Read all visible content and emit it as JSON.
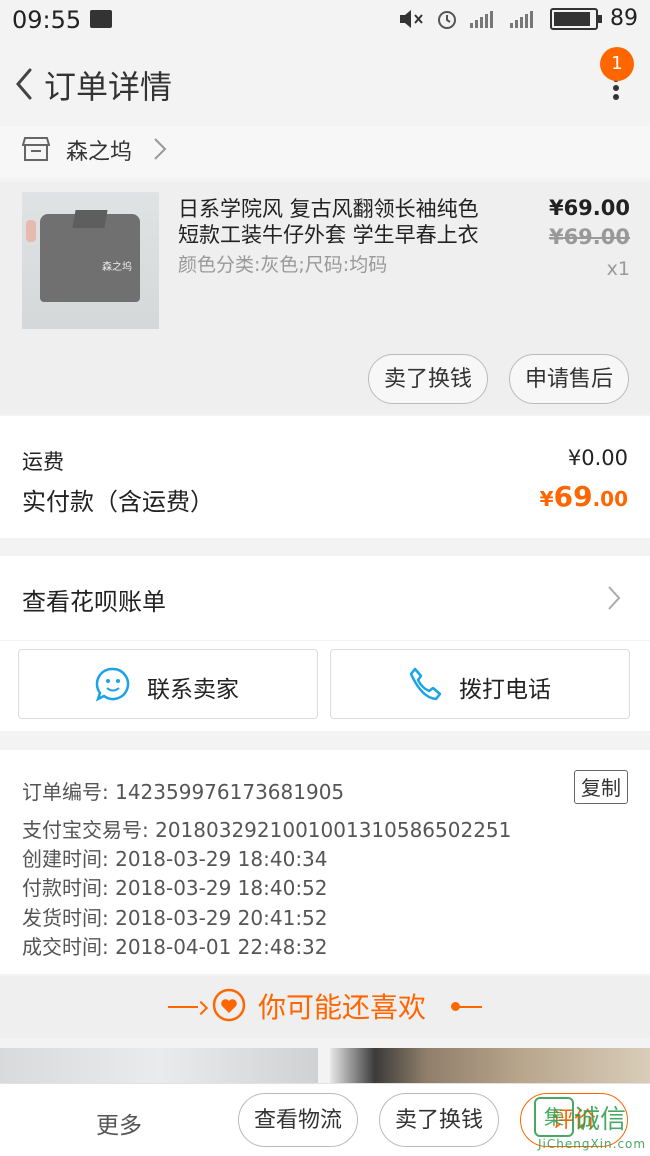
{
  "status_bar": {
    "time": "09:55",
    "battery": "89"
  },
  "header": {
    "title": "订单详情",
    "badge_count": "1"
  },
  "shop": {
    "name": "森之坞"
  },
  "item": {
    "name": "日系学院风 复古风翻领长袖纯色短款工装牛仔外套 学生早春上衣",
    "spec": "颜色分类:灰色;尺码:均码",
    "price": "¥69.00",
    "original_price": "¥69.00",
    "quantity": "x1",
    "thumb_watermark": "森之坞",
    "actions": [
      "卖了换钱",
      "申请售后"
    ]
  },
  "fees": {
    "shipping_label": "运费",
    "shipping_value": "¥0.00",
    "paid_label": "实付款（含运费）",
    "paid_currency": "¥",
    "paid_int": "69",
    "paid_dec": ".00"
  },
  "huabei": {
    "label": "查看花呗账单"
  },
  "contact": {
    "seller": "联系卖家",
    "call": "拨打电话"
  },
  "order_info": {
    "copy_label": "复制",
    "rows": [
      "订单编号: 142359976173681905",
      "支付宝交易号: 2018032921001001310586502251",
      "创建时间: 2018-03-29 18:40:34",
      "付款时间: 2018-03-29 18:40:52",
      "发货时间: 2018-03-29 20:41:52",
      "成交时间: 2018-04-01 22:48:32"
    ]
  },
  "recommend": {
    "title": "你可能还喜欢"
  },
  "bottom_bar": {
    "more": "更多",
    "logistics": "查看物流",
    "resell": "卖了换钱",
    "review": "评价"
  },
  "watermark": {
    "cn": "诚信",
    "en": "JiChengXin.com",
    "mark": "集"
  },
  "colors": {
    "accent": "#ff6600",
    "background": "#f3f3f3"
  }
}
